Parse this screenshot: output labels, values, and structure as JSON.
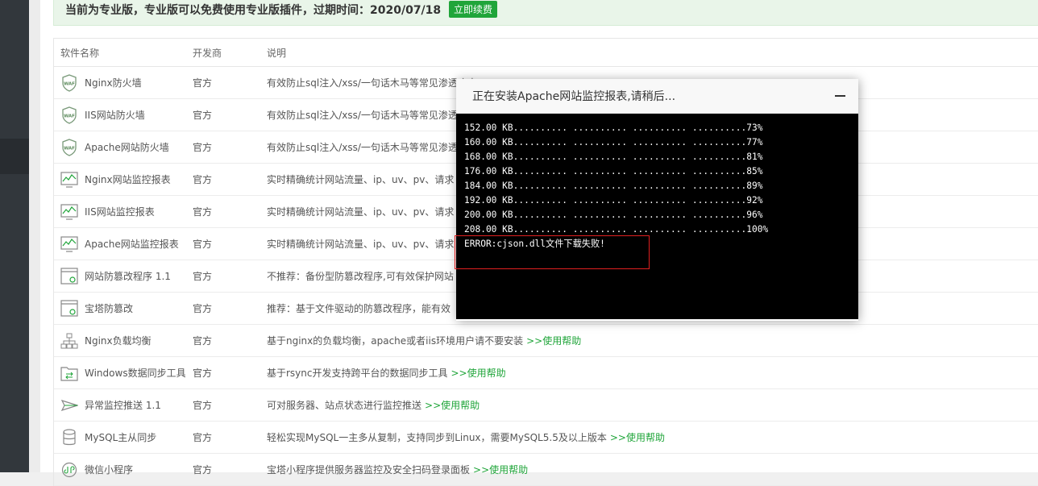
{
  "banner": {
    "text": "当前为专业版，专业版可以免费使用专业版插件，过期时间：2020/07/18",
    "renew_label": "立即续费"
  },
  "table": {
    "headers": [
      "软件名称",
      "开发商",
      "说明"
    ],
    "rows": [
      {
        "icon": "waf-shield-icon",
        "name": "Nginx防火墙",
        "vendor": "官方",
        "desc": "有效防止sql注入/xss/一句话木马等常见渗透攻击",
        "help": ""
      },
      {
        "icon": "waf-shield-icon",
        "name": "IIS网站防火墙",
        "vendor": "官方",
        "desc": "有效防止sql注入/xss/一句话木马等常见渗透",
        "help": ""
      },
      {
        "icon": "waf-shield-icon",
        "name": "Apache网站防火墙",
        "vendor": "官方",
        "desc": "有效防止sql注入/xss/一句话木马等常见渗透",
        "help": ""
      },
      {
        "icon": "monitor-chart-icon",
        "name": "Nginx网站监控报表",
        "vendor": "官方",
        "desc": "实时精确统计网站流量、ip、uv、pv、请求",
        "help": ""
      },
      {
        "icon": "monitor-chart-icon",
        "name": "IIS网站监控报表",
        "vendor": "官方",
        "desc": "实时精确统计网站流量、ip、uv、pv、请求",
        "help": ""
      },
      {
        "icon": "monitor-chart-icon",
        "name": "Apache网站监控报表",
        "vendor": "官方",
        "desc": "实时精确统计网站流量、ip、uv、pv、请求",
        "help": ""
      },
      {
        "icon": "tamper-proof-icon",
        "name": "网站防篡改程序 1.1",
        "vendor": "官方",
        "desc": "不推荐：备份型防篡改程序,可有效保护网站",
        "help": ""
      },
      {
        "icon": "tamper-proof-icon",
        "name": "宝塔防篡改",
        "vendor": "官方",
        "desc": "推荐：基于文件驱动的防篡改程序，能有效",
        "help": ""
      },
      {
        "icon": "load-balance-icon",
        "name": "Nginx负载均衡",
        "vendor": "官方",
        "desc": "基于nginx的负载均衡，apache或者iis环境用户请不要安装",
        "help": ">>使用帮助"
      },
      {
        "icon": "folder-sync-icon",
        "name": "Windows数据同步工具",
        "vendor": "官方",
        "desc": "基于rsync开发支持跨平台的数据同步工具",
        "help": ">>使用帮助"
      },
      {
        "icon": "mail-push-icon",
        "name": "异常监控推送 1.1",
        "vendor": "官方",
        "desc": "可对服务器、站点状态进行监控推送",
        "help": ">>使用帮助"
      },
      {
        "icon": "database-icon",
        "name": "MySQL主从同步",
        "vendor": "官方",
        "desc": "轻松实现MySQL一主多从复制，支持同步到Linux，需要MySQL5.5及以上版本",
        "help": ">>使用帮助"
      },
      {
        "icon": "wechat-app-icon",
        "name": "微信小程序",
        "vendor": "官方",
        "desc": "宝塔小程序提供服务器监控及安全扫码登录面板",
        "help": ">>使用帮助"
      }
    ]
  },
  "dialog": {
    "title": "正在安装Apache网站监控报表,请稍后...",
    "log": [
      "152.00 KB.......... .......... .......... ..........73%",
      "160.00 KB.......... .......... .......... ..........77%",
      "168.00 KB.......... .......... .......... ..........81%",
      "176.00 KB.......... .......... .......... ..........85%",
      "184.00 KB.......... .......... .......... ..........89%",
      "192.00 KB.......... .......... .......... ..........92%",
      "200.00 KB.......... .......... .......... ..........96%",
      "208.00 KB.......... .......... .......... ..........100%",
      "ERROR:cjson.dll文件下载失败!"
    ]
  },
  "colors": {
    "accent": "#20a53a",
    "error_box": "#e02020"
  }
}
